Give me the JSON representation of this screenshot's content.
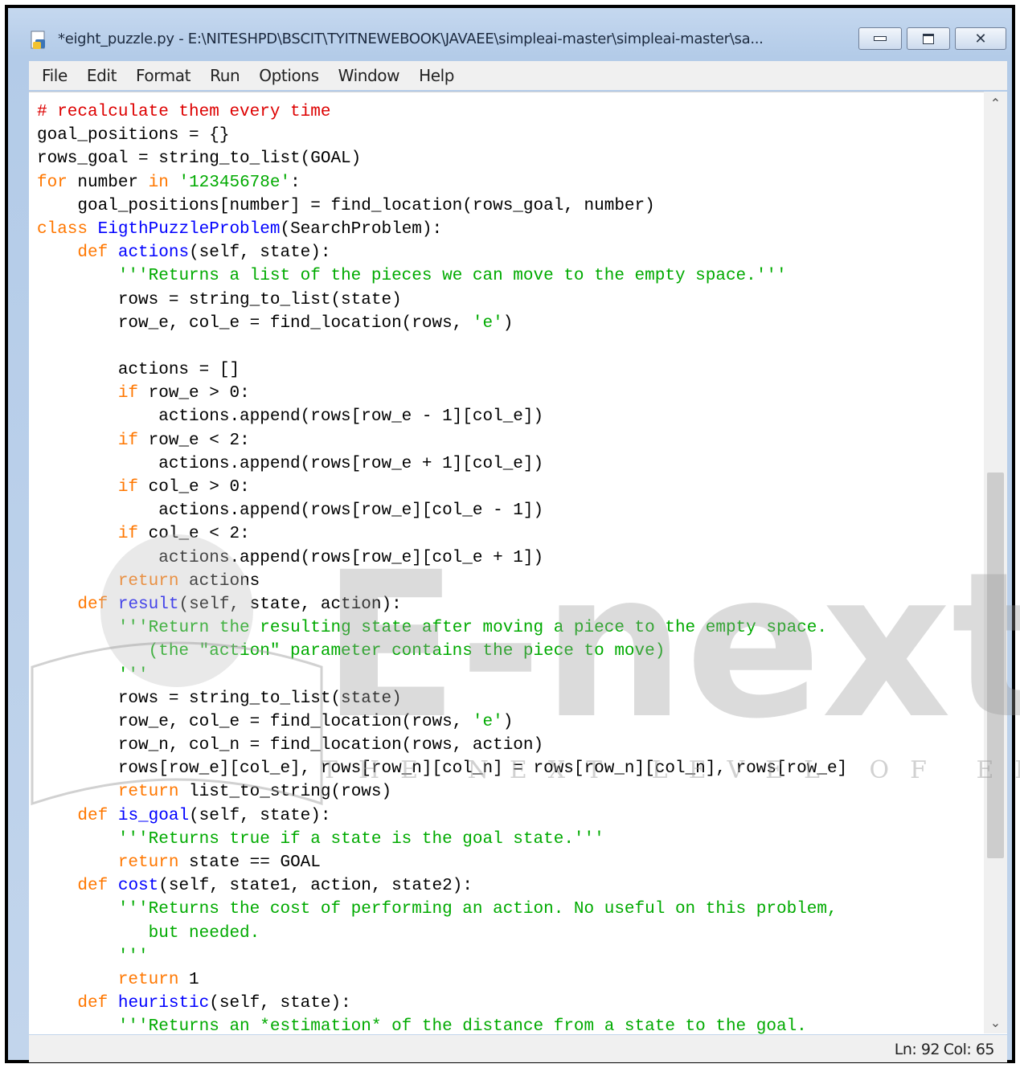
{
  "window": {
    "title": "*eight_puzzle.py - E:\\NITESHPD\\BSCIT\\TYITNEWEBOOK\\JAVAEE\\simpleai-master\\simpleai-master\\sa...",
    "controls": {
      "minimize": "minimize",
      "maximize": "maximize",
      "close": "close"
    }
  },
  "menu": {
    "items": [
      "File",
      "Edit",
      "Format",
      "Run",
      "Options",
      "Window",
      "Help"
    ]
  },
  "editor": {
    "language": "python",
    "lines": [
      [
        [
          "com",
          "# recalculate them every time"
        ]
      ],
      [
        [
          "",
          "goal_positions = {}"
        ]
      ],
      [
        [
          "",
          "rows_goal = string_to_list(GOAL)"
        ]
      ],
      [
        [
          "kw",
          "for"
        ],
        [
          "",
          " number "
        ],
        [
          "kw",
          "in"
        ],
        [
          "",
          " "
        ],
        [
          "str",
          "'12345678e'"
        ],
        [
          "",
          ":"
        ]
      ],
      [
        [
          "",
          "    goal_positions[number] = find_location(rows_goal, number)"
        ]
      ],
      [
        [
          "kw",
          "class"
        ],
        [
          "",
          " "
        ],
        [
          "def",
          "EigthPuzzleProblem"
        ],
        [
          "",
          "(SearchProblem):"
        ]
      ],
      [
        [
          "",
          "    "
        ],
        [
          "kw",
          "def"
        ],
        [
          "",
          " "
        ],
        [
          "def",
          "actions"
        ],
        [
          "",
          "(self, state):"
        ]
      ],
      [
        [
          "",
          "        "
        ],
        [
          "str",
          "'''Returns a list of the pieces we can move to the empty space.'''"
        ]
      ],
      [
        [
          "",
          "        rows = string_to_list(state)"
        ]
      ],
      [
        [
          "",
          "        row_e, col_e = find_location(rows, "
        ],
        [
          "str",
          "'e'"
        ],
        [
          "",
          ")"
        ]
      ],
      [
        [
          "",
          ""
        ]
      ],
      [
        [
          "",
          "        actions = []"
        ]
      ],
      [
        [
          "",
          "        "
        ],
        [
          "kw",
          "if"
        ],
        [
          "",
          " row_e > 0:"
        ]
      ],
      [
        [
          "",
          "            actions.append(rows[row_e - 1][col_e])"
        ]
      ],
      [
        [
          "",
          "        "
        ],
        [
          "kw",
          "if"
        ],
        [
          "",
          " row_e < 2:"
        ]
      ],
      [
        [
          "",
          "            actions.append(rows[row_e + 1][col_e])"
        ]
      ],
      [
        [
          "",
          "        "
        ],
        [
          "kw",
          "if"
        ],
        [
          "",
          " col_e > 0:"
        ]
      ],
      [
        [
          "",
          "            actions.append(rows[row_e][col_e - 1])"
        ]
      ],
      [
        [
          "",
          "        "
        ],
        [
          "kw",
          "if"
        ],
        [
          "",
          " col_e < 2:"
        ]
      ],
      [
        [
          "",
          "            actions.append(rows[row_e][col_e + 1])"
        ]
      ],
      [
        [
          "",
          "        "
        ],
        [
          "kw",
          "return"
        ],
        [
          "",
          " actions"
        ]
      ],
      [
        [
          "",
          "    "
        ],
        [
          "kw",
          "def"
        ],
        [
          "",
          " "
        ],
        [
          "def",
          "result"
        ],
        [
          "",
          "(self, state, action):"
        ]
      ],
      [
        [
          "",
          "        "
        ],
        [
          "str",
          "'''Return the resulting state after moving a piece to the empty space."
        ]
      ],
      [
        [
          "str",
          "           (the \"action\" parameter contains the piece to move)"
        ]
      ],
      [
        [
          "",
          "        "
        ],
        [
          "str",
          "'''"
        ]
      ],
      [
        [
          "",
          "        rows = string_to_list(state)"
        ]
      ],
      [
        [
          "",
          "        row_e, col_e = find_location(rows, "
        ],
        [
          "str",
          "'e'"
        ],
        [
          "",
          ")"
        ]
      ],
      [
        [
          "",
          "        row_n, col_n = find_location(rows, action)"
        ]
      ],
      [
        [
          "",
          "        rows[row_e][col_e], rows[row_n][col_n] = rows[row_n][col_n], rows[row_e]"
        ]
      ],
      [
        [
          "",
          "        "
        ],
        [
          "kw",
          "return"
        ],
        [
          "",
          " list_to_string(rows)"
        ]
      ],
      [
        [
          "",
          "    "
        ],
        [
          "kw",
          "def"
        ],
        [
          "",
          " "
        ],
        [
          "def",
          "is_goal"
        ],
        [
          "",
          "(self, state):"
        ]
      ],
      [
        [
          "",
          "        "
        ],
        [
          "str",
          "'''Returns true if a state is the goal state.'''"
        ]
      ],
      [
        [
          "",
          "        "
        ],
        [
          "kw",
          "return"
        ],
        [
          "",
          " state == GOAL"
        ]
      ],
      [
        [
          "",
          "    "
        ],
        [
          "kw",
          "def"
        ],
        [
          "",
          " "
        ],
        [
          "def",
          "cost"
        ],
        [
          "",
          "(self, state1, action, state2):"
        ]
      ],
      [
        [
          "",
          "        "
        ],
        [
          "str",
          "'''Returns the cost of performing an action. No useful on this problem,"
        ]
      ],
      [
        [
          "str",
          "           but needed."
        ]
      ],
      [
        [
          "",
          "        "
        ],
        [
          "str",
          "'''"
        ]
      ],
      [
        [
          "",
          "        "
        ],
        [
          "kw",
          "return"
        ],
        [
          "",
          " 1"
        ]
      ],
      [
        [
          "",
          "    "
        ],
        [
          "kw",
          "def"
        ],
        [
          "",
          " "
        ],
        [
          "def",
          "heuristic"
        ],
        [
          "",
          "(self, state):"
        ]
      ],
      [
        [
          "",
          "        "
        ],
        [
          "str",
          "'''Returns an *estimation* of the distance from a state to the goal."
        ]
      ]
    ]
  },
  "status": {
    "line": "Ln: 92",
    "column": "Col: 65"
  },
  "watermark": {
    "brand": "E-next",
    "tagline": "THE NEXT LEVEL OF EDUCATION"
  },
  "colors": {
    "keyword": "#ff7700",
    "definition": "#0000ff",
    "string": "#00aa00",
    "comment": "#dd0000",
    "builtin": "#900090"
  }
}
